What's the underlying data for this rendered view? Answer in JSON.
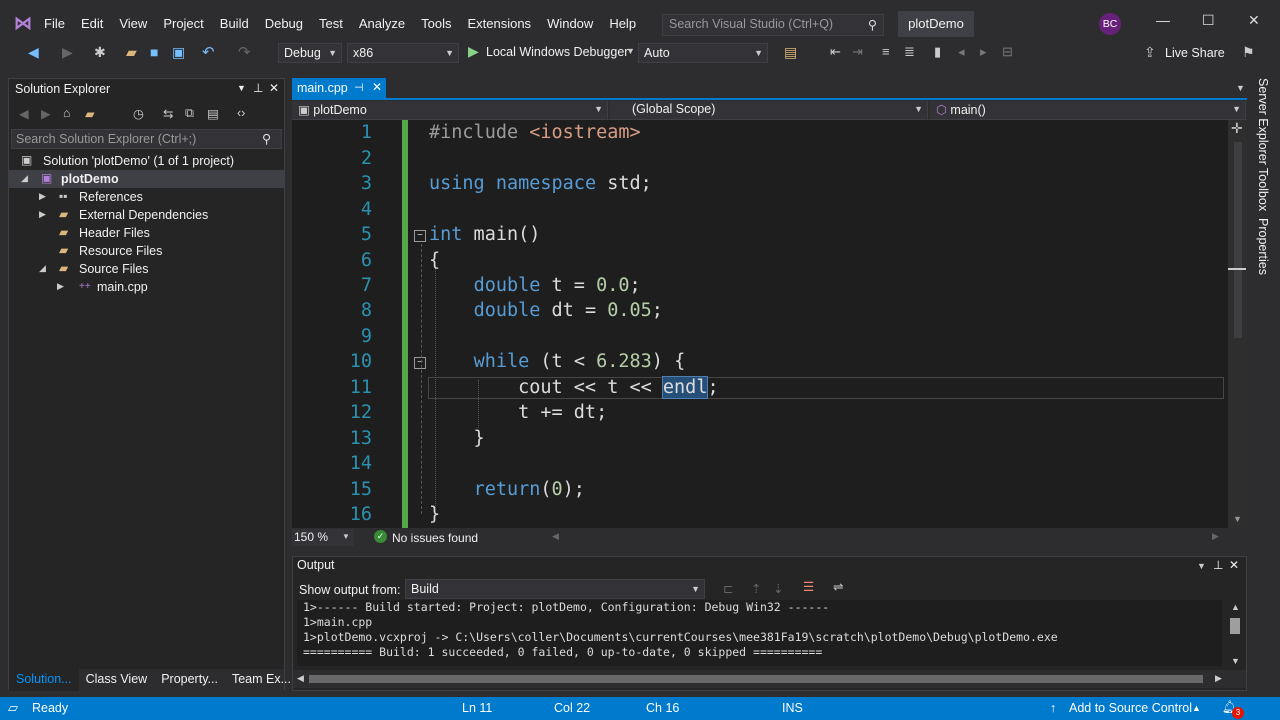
{
  "menu": [
    "File",
    "Edit",
    "View",
    "Project",
    "Build",
    "Debug",
    "Test",
    "Analyze",
    "Tools",
    "Extensions",
    "Window",
    "Help"
  ],
  "search": {
    "placeholder": "Search Visual Studio (Ctrl+Q)"
  },
  "project_name": "plotDemo",
  "user_initials": "BC",
  "toolbar": {
    "config": "Debug",
    "platform": "x86",
    "debugger": "Local Windows Debugger",
    "auto": "Auto",
    "live_share": "Live Share"
  },
  "solution_explorer": {
    "title": "Solution Explorer",
    "search_placeholder": "Search Solution Explorer (Ctrl+;)",
    "items": [
      {
        "label": "Solution 'plotDemo' (1 of 1 project)"
      },
      {
        "label": "plotDemo"
      },
      {
        "label": "References"
      },
      {
        "label": "External Dependencies"
      },
      {
        "label": "Header Files"
      },
      {
        "label": "Resource Files"
      },
      {
        "label": "Source Files"
      },
      {
        "label": "main.cpp"
      }
    ],
    "tabs": [
      "Solution...",
      "Class View",
      "Property...",
      "Team Ex..."
    ]
  },
  "editor": {
    "tab": "main.cpp",
    "nav_project": "plotDemo",
    "nav_scope": "(Global Scope)",
    "nav_member": "main()",
    "zoom": "150 %",
    "issues": "No issues found",
    "lines": [
      "1",
      "2",
      "3",
      "4",
      "5",
      "6",
      "7",
      "8",
      "9",
      "10",
      "11",
      "12",
      "13",
      "14",
      "15",
      "16"
    ]
  },
  "output": {
    "title": "Output",
    "show_from_label": "Show output from:",
    "source": "Build",
    "lines": [
      "1>------ Build started: Project: plotDemo, Configuration: Debug Win32 ------",
      "1>main.cpp",
      "1>plotDemo.vcxproj -> C:\\Users\\coller\\Documents\\currentCourses\\mee381Fa19\\scratch\\plotDemo\\Debug\\plotDemo.exe",
      "========== Build: 1 succeeded, 0 failed, 0 up-to-date, 0 skipped =========="
    ]
  },
  "side_tabs": [
    "Server Explorer",
    "Toolbox",
    "Properties"
  ],
  "status": {
    "ready": "Ready",
    "ln": "Ln 11",
    "col": "Col 22",
    "ch": "Ch 16",
    "ins": "INS",
    "source_control": "Add to Source Control",
    "notifications": "3"
  },
  "colors": {
    "accent": "#007acc",
    "keyword": "#569cd6",
    "number": "#b5cea8",
    "string": "#d69d85",
    "line_number": "#2b91af"
  }
}
